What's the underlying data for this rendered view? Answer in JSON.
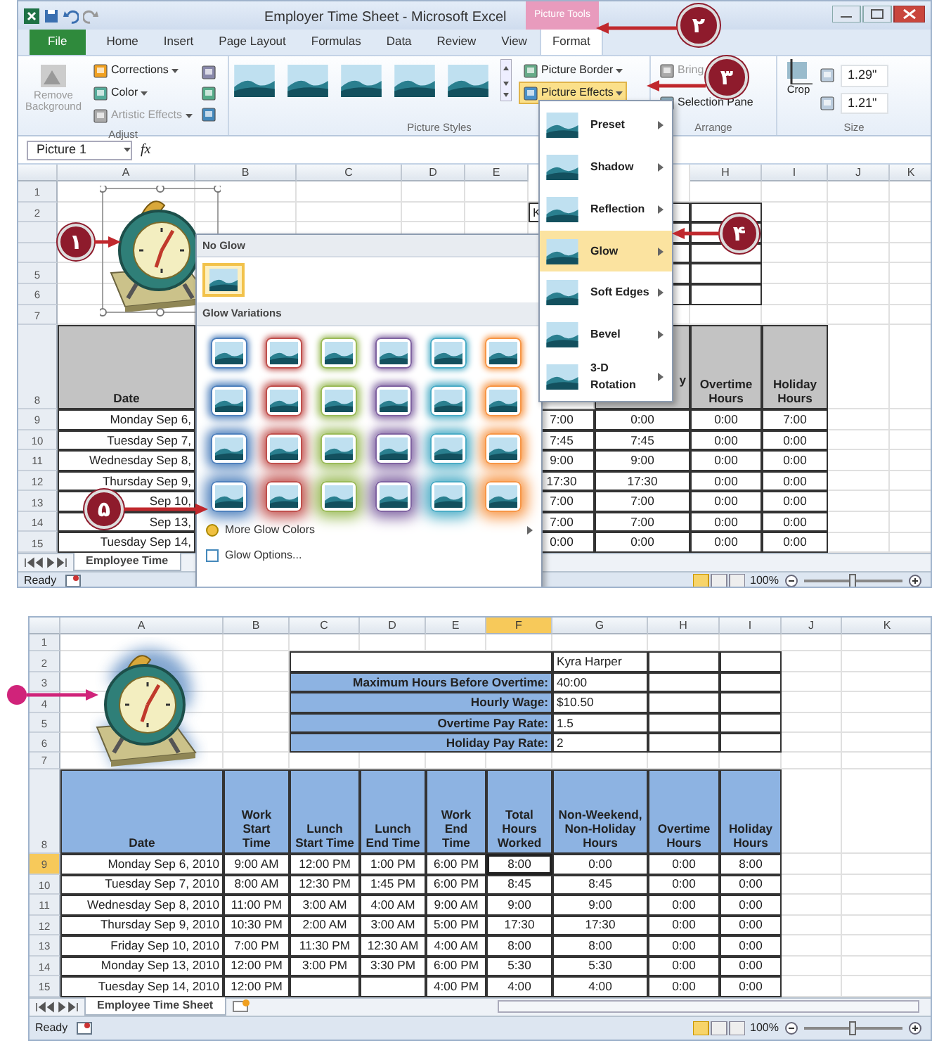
{
  "callouts": [
    {
      "number": "١"
    },
    {
      "number": "٢"
    },
    {
      "number": "٣"
    },
    {
      "number": "۴"
    },
    {
      "number": "۵"
    }
  ],
  "screens": [
    {
      "title_bar": {
        "title": "Employer Time Sheet - Microsoft Excel",
        "context_tab": "Picture Tools"
      },
      "ribbon_tabs": [
        {
          "label": "File",
          "selected": false
        },
        {
          "label": "Home",
          "selected": false
        },
        {
          "label": "Insert",
          "selected": false
        },
        {
          "label": "Page Layout",
          "selected": false
        },
        {
          "label": "Formulas",
          "selected": false
        },
        {
          "label": "Data",
          "selected": false
        },
        {
          "label": "Review",
          "selected": false
        },
        {
          "label": "View",
          "selected": false
        },
        {
          "label": "Format",
          "selected": true
        }
      ],
      "ribbon_groups": [
        {
          "label": "Adjust",
          "items": [
            {
              "label": "Remove Background",
              "disabled": true
            },
            {
              "label": "Corrections",
              "disabled": false
            },
            {
              "label": "Color",
              "disabled": false
            },
            {
              "label": "Artistic Effects",
              "disabled": true
            }
          ]
        },
        {
          "label": "Picture Styles",
          "items": [
            {
              "label": "Picture Border",
              "selected": false
            },
            {
              "label": "Picture Effects",
              "selected": true
            }
          ]
        },
        {
          "label": "Arrange",
          "items": [
            {
              "label": "Bring",
              "disabled": true
            },
            {
              "label": "Selection Pane",
              "disabled": false
            }
          ]
        },
        {
          "label": "Size",
          "items": [
            {
              "label": "Crop"
            },
            {
              "label": "1.29\""
            },
            {
              "label": "1.21\""
            }
          ]
        }
      ],
      "name_box": "Picture 1",
      "fx_label": "fx",
      "columns": {
        "A": {
          "label": "A",
          "selected": false
        },
        "B": {
          "label": "B",
          "selected": false
        },
        "C": {
          "label": "C",
          "selected": false
        },
        "D": {
          "label": "D",
          "selected": false
        },
        "E": {
          "label": "E",
          "selected": false
        },
        "H": {
          "label": "H",
          "selected": false
        },
        "I": {
          "label": "I",
          "selected": false
        },
        "J": {
          "label": "J",
          "selected": false
        },
        "K": {
          "label": "K",
          "selected": false
        }
      },
      "rows": [
        {
          "number": "1",
          "selected": false,
          "cells": {}
        },
        {
          "number": "2",
          "selected": false,
          "cells": {
            "F": {
              "kind": "value",
              "text": "K"
            },
            "G": {
              "kind": "value"
            },
            "H": {
              "kind": "value"
            }
          }
        },
        {
          "selected": false,
          "cells": {
            "G": {
              "kind": "value"
            },
            "H": {
              "kind": "value"
            }
          }
        },
        {
          "selected": false,
          "cells": {
            "G": {
              "kind": "value"
            },
            "H": {
              "kind": "value"
            }
          }
        },
        {
          "number": "5",
          "selected": false,
          "cells": {
            "G": {
              "kind": "value"
            },
            "H": {
              "kind": "value"
            }
          }
        },
        {
          "number": "6",
          "selected": false,
          "cells": {
            "G": {
              "kind": "value"
            },
            "H": {
              "kind": "value"
            }
          }
        },
        {
          "number": "7",
          "selected": false,
          "cells": {}
        },
        {
          "number": "8",
          "selected": false,
          "cells": {
            "A": {
              "kind": "header",
              "text": "Date"
            },
            "G": {
              "kind": "header-tail",
              "text": "y"
            },
            "H": {
              "kind": "header",
              "text": "Overtime Hours"
            },
            "I": {
              "kind": "header",
              "text": "Holiday Hours"
            }
          }
        },
        {
          "number": "9",
          "selected": false,
          "cells": {
            "A": {
              "kind": "date",
              "text": "Monday Sep 6,"
            },
            "F": {
              "kind": "num",
              "text": "7:00"
            },
            "G": {
              "kind": "num",
              "text": "0:00"
            },
            "H": {
              "kind": "num",
              "text": "0:00"
            },
            "I": {
              "kind": "num",
              "text": "7:00"
            }
          }
        },
        {
          "number": "10",
          "selected": false,
          "cells": {
            "A": {
              "kind": "date",
              "text": "Tuesday Sep 7,"
            },
            "F": {
              "kind": "num",
              "text": "7:45"
            },
            "G": {
              "kind": "num",
              "text": "7:45"
            },
            "H": {
              "kind": "num",
              "text": "0:00"
            },
            "I": {
              "kind": "num",
              "text": "0:00"
            }
          }
        },
        {
          "number": "11",
          "selected": false,
          "cells": {
            "A": {
              "kind": "date",
              "text": "Wednesday Sep 8,"
            },
            "F": {
              "kind": "num",
              "text": "9:00"
            },
            "G": {
              "kind": "num",
              "text": "9:00"
            },
            "H": {
              "kind": "num",
              "text": "0:00"
            },
            "I": {
              "kind": "num",
              "text": "0:00"
            }
          }
        },
        {
          "number": "12",
          "selected": false,
          "cells": {
            "A": {
              "kind": "date",
              "text": "Thursday Sep 9,"
            },
            "F": {
              "kind": "num",
              "text": "17:30"
            },
            "G": {
              "kind": "num",
              "text": "17:30"
            },
            "H": {
              "kind": "num",
              "text": "0:00"
            },
            "I": {
              "kind": "num",
              "text": "0:00"
            }
          }
        },
        {
          "number": "13",
          "selected": false,
          "cells": {
            "A": {
              "kind": "date",
              "text": "Sep 10,"
            },
            "F": {
              "kind": "num",
              "text": "7:00"
            },
            "G": {
              "kind": "num",
              "text": "7:00"
            },
            "H": {
              "kind": "num",
              "text": "0:00"
            },
            "I": {
              "kind": "num",
              "text": "0:00"
            }
          }
        },
        {
          "number": "14",
          "selected": false,
          "cells": {
            "A": {
              "kind": "date",
              "text": "Sep 13,"
            },
            "F": {
              "kind": "num",
              "text": "7:00"
            },
            "G": {
              "kind": "num",
              "text": "7:00"
            },
            "H": {
              "kind": "num",
              "text": "0:00"
            },
            "I": {
              "kind": "num",
              "text": "0:00"
            }
          }
        },
        {
          "number": "15",
          "selected": false,
          "cells": {
            "A": {
              "kind": "date",
              "text": "Tuesday Sep 14,"
            },
            "F": {
              "kind": "num",
              "text": "0:00"
            },
            "G": {
              "kind": "num",
              "text": "0:00"
            },
            "H": {
              "kind": "num",
              "text": "0:00"
            },
            "I": {
              "kind": "num",
              "text": "0:00"
            }
          }
        }
      ],
      "sheet_tab": "Employee Time",
      "status": {
        "text": "Ready",
        "zoom": "100%",
        "zoom_slider": {
          "level": 0.5
        }
      },
      "effects_menu": [
        {
          "label": "Preset",
          "selected": false
        },
        {
          "label": "Shadow",
          "selected": false
        },
        {
          "label": "Reflection",
          "selected": false
        },
        {
          "label": "Glow",
          "selected": true
        },
        {
          "label": "Soft Edges",
          "selected": false
        },
        {
          "label": "Bevel",
          "selected": false
        },
        {
          "label": "3-D Rotation",
          "selected": false
        }
      ],
      "glow_gallery": {
        "header": "No Glow",
        "no_glow": {
          "selected": true
        },
        "variations_header": "Glow Variations",
        "variations": [
          [
            {
              "color": "#4f81bd"
            },
            {
              "color": "#c0504d"
            },
            {
              "color": "#9bbb59"
            },
            {
              "color": "#8064a2"
            },
            {
              "color": "#4bacc6"
            },
            {
              "color": "#f79646"
            }
          ],
          [
            {
              "color": "#4f81bd"
            },
            {
              "color": "#c0504d"
            },
            {
              "color": "#9bbb59"
            },
            {
              "color": "#8064a2"
            },
            {
              "color": "#4bacc6"
            },
            {
              "color": "#f79646"
            }
          ],
          [
            {
              "color": "#4f81bd"
            },
            {
              "color": "#c0504d"
            },
            {
              "color": "#9bbb59"
            },
            {
              "color": "#8064a2"
            },
            {
              "color": "#4bacc6"
            },
            {
              "color": "#f79646"
            }
          ],
          [
            {
              "color": "#4f81bd"
            },
            {
              "color": "#c0504d"
            },
            {
              "color": "#9bbb59"
            },
            {
              "color": "#8064a2"
            },
            {
              "color": "#4bacc6"
            },
            {
              "color": "#f79646"
            }
          ]
        ],
        "more_colors": "More Glow Colors",
        "options": "Glow Options..."
      }
    },
    {
      "columns": {
        "A": {
          "label": "A",
          "selected": false
        },
        "B": {
          "label": "B",
          "selected": false
        },
        "C": {
          "label": "C",
          "selected": false
        },
        "D": {
          "label": "D",
          "selected": false
        },
        "E": {
          "label": "E",
          "selected": false
        },
        "F": {
          "label": "F",
          "selected": true
        },
        "G": {
          "label": "G",
          "selected": false
        },
        "H": {
          "label": "H",
          "selected": false
        },
        "I": {
          "label": "I",
          "selected": false
        },
        "J": {
          "label": "J",
          "selected": false
        },
        "K": {
          "label": "K",
          "selected": false
        }
      },
      "rows": [
        {
          "number": "1",
          "selected": false,
          "cells": {}
        },
        {
          "number": "2",
          "selected": false,
          "cells": {
            "C:F": {
              "kind": "value"
            },
            "G": {
              "kind": "value",
              "text": "Kyra Harper"
            },
            "H": {
              "kind": "value"
            },
            "I": {
              "kind": "value"
            }
          }
        },
        {
          "number": "3",
          "selected": false,
          "cells": {
            "C:F": {
              "kind": "label",
              "text": "Maximum Hours Before Overtime:"
            },
            "G": {
              "kind": "value",
              "text": "40:00"
            },
            "H": {
              "kind": "value"
            },
            "I": {
              "kind": "value"
            }
          }
        },
        {
          "number": "4",
          "selected": false,
          "cells": {
            "C:F": {
              "kind": "label",
              "text": "Hourly Wage:"
            },
            "G": {
              "kind": "value",
              "text": "$10.50"
            },
            "H": {
              "kind": "value"
            },
            "I": {
              "kind": "value"
            }
          }
        },
        {
          "number": "5",
          "selected": false,
          "cells": {
            "C:F": {
              "kind": "label",
              "text": "Overtime Pay Rate:"
            },
            "G": {
              "kind": "value",
              "text": "1.5"
            },
            "H": {
              "kind": "value"
            },
            "I": {
              "kind": "value"
            }
          }
        },
        {
          "number": "6",
          "selected": false,
          "cells": {
            "C:F": {
              "kind": "label",
              "text": "Holiday Pay Rate:"
            },
            "G": {
              "kind": "value",
              "text": "2"
            },
            "H": {
              "kind": "value"
            },
            "I": {
              "kind": "value"
            }
          }
        },
        {
          "number": "7",
          "selected": false,
          "cells": {}
        },
        {
          "number": "8",
          "selected": false,
          "cells": {
            "A": {
              "kind": "header",
              "text": "Date"
            },
            "B": {
              "kind": "header",
              "text": "Work Start Time"
            },
            "C": {
              "kind": "header",
              "text": "Lunch Start Time"
            },
            "D": {
              "kind": "header",
              "text": "Lunch End Time"
            },
            "E": {
              "kind": "header",
              "text": "Work End Time"
            },
            "F": {
              "kind": "header",
              "text": "Total Hours Worked"
            },
            "G": {
              "kind": "header",
              "text": "Non-Weekend, Non-Holiday Hours"
            },
            "H": {
              "kind": "header",
              "text": "Overtime Hours"
            },
            "I": {
              "kind": "header",
              "text": "Holiday Hours"
            }
          }
        },
        {
          "number": "9",
          "selected": true,
          "cells": {
            "A": {
              "kind": "date",
              "text": "Monday Sep 6, 2010"
            },
            "B": {
              "kind": "num",
              "text": "9:00 AM"
            },
            "C": {
              "kind": "num",
              "text": "12:00 PM"
            },
            "D": {
              "kind": "num",
              "text": "1:00 PM"
            },
            "E": {
              "kind": "num",
              "text": "6:00 PM"
            },
            "F": {
              "kind": "num",
              "text": "8:00"
            },
            "G": {
              "kind": "num",
              "text": "0:00"
            },
            "H": {
              "kind": "num",
              "text": "0:00"
            },
            "I": {
              "kind": "num",
              "text": "8:00"
            }
          }
        },
        {
          "number": "10",
          "selected": false,
          "cells": {
            "A": {
              "kind": "date",
              "text": "Tuesday Sep 7, 2010"
            },
            "B": {
              "kind": "num",
              "text": "8:00 AM"
            },
            "C": {
              "kind": "num",
              "text": "12:30 PM"
            },
            "D": {
              "kind": "num",
              "text": "1:45 PM"
            },
            "E": {
              "kind": "num",
              "text": "6:00 PM"
            },
            "F": {
              "kind": "num",
              "text": "8:45"
            },
            "G": {
              "kind": "num",
              "text": "8:45"
            },
            "H": {
              "kind": "num",
              "text": "0:00"
            },
            "I": {
              "kind": "num",
              "text": "0:00"
            }
          }
        },
        {
          "number": "11",
          "selected": false,
          "cells": {
            "A": {
              "kind": "date",
              "text": "Wednesday Sep 8, 2010"
            },
            "B": {
              "kind": "num",
              "text": "11:00 PM"
            },
            "C": {
              "kind": "num",
              "text": "3:00 AM"
            },
            "D": {
              "kind": "num",
              "text": "4:00 AM"
            },
            "E": {
              "kind": "num",
              "text": "9:00 AM"
            },
            "F": {
              "kind": "num",
              "text": "9:00"
            },
            "G": {
              "kind": "num",
              "text": "9:00"
            },
            "H": {
              "kind": "num",
              "text": "0:00"
            },
            "I": {
              "kind": "num",
              "text": "0:00"
            }
          }
        },
        {
          "number": "12",
          "selected": false,
          "cells": {
            "A": {
              "kind": "date",
              "text": "Thursday Sep 9, 2010"
            },
            "B": {
              "kind": "num",
              "text": "10:30 PM"
            },
            "C": {
              "kind": "num",
              "text": "2:00 AM"
            },
            "D": {
              "kind": "num",
              "text": "3:00 AM"
            },
            "E": {
              "kind": "num",
              "text": "5:00 PM"
            },
            "F": {
              "kind": "num",
              "text": "17:30"
            },
            "G": {
              "kind": "num",
              "text": "17:30"
            },
            "H": {
              "kind": "num",
              "text": "0:00"
            },
            "I": {
              "kind": "num",
              "text": "0:00"
            }
          }
        },
        {
          "number": "13",
          "selected": false,
          "cells": {
            "A": {
              "kind": "date",
              "text": "Friday Sep 10, 2010"
            },
            "B": {
              "kind": "num",
              "text": "7:00 PM"
            },
            "C": {
              "kind": "num",
              "text": "11:30 PM"
            },
            "D": {
              "kind": "num",
              "text": "12:30 AM"
            },
            "E": {
              "kind": "num",
              "text": "4:00 AM"
            },
            "F": {
              "kind": "num",
              "text": "8:00"
            },
            "G": {
              "kind": "num",
              "text": "8:00"
            },
            "H": {
              "kind": "num",
              "text": "0:00"
            },
            "I": {
              "kind": "num",
              "text": "0:00"
            }
          }
        },
        {
          "number": "14",
          "selected": false,
          "cells": {
            "A": {
              "kind": "date",
              "text": "Monday Sep 13, 2010"
            },
            "B": {
              "kind": "num",
              "text": "12:00 PM"
            },
            "C": {
              "kind": "num",
              "text": "3:00 PM"
            },
            "D": {
              "kind": "num",
              "text": "3:30 PM"
            },
            "E": {
              "kind": "num",
              "text": "6:00 PM"
            },
            "F": {
              "kind": "num",
              "text": "5:30"
            },
            "G": {
              "kind": "num",
              "text": "5:30"
            },
            "H": {
              "kind": "num",
              "text": "0:00"
            },
            "I": {
              "kind": "num",
              "text": "0:00"
            }
          }
        },
        {
          "number": "15",
          "selected": false,
          "cells": {
            "A": {
              "kind": "date",
              "text": "Tuesday Sep 14, 2010"
            },
            "B": {
              "kind": "num",
              "text": "12:00 PM"
            },
            "C": {
              "kind": "num"
            },
            "D": {
              "kind": "num"
            },
            "E": {
              "kind": "num",
              "text": "4:00 PM"
            },
            "F": {
              "kind": "num",
              "text": "4:00"
            },
            "G": {
              "kind": "num",
              "text": "4:00"
            },
            "H": {
              "kind": "num",
              "text": "0:00"
            },
            "I": {
              "kind": "num",
              "text": "0:00"
            }
          }
        }
      ],
      "sheet_tab": "Employee Time Sheet",
      "status": {
        "text": "Ready",
        "zoom": "100%",
        "zoom_slider": {
          "level": 0.5
        }
      }
    }
  ]
}
